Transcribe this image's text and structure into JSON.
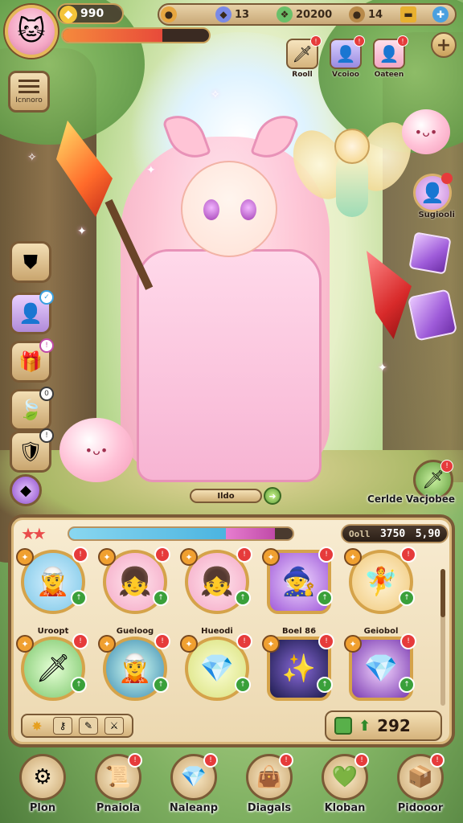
{
  "hud": {
    "gold": "990",
    "gem_a": "13",
    "gem_b": "20200",
    "gem_c": "14",
    "hp_percent": 68,
    "add_label": "+"
  },
  "menu": {
    "label": "Icnnoro"
  },
  "top_icons": [
    {
      "label": "Rooll",
      "icon": "sword-icon"
    },
    {
      "label": "Vcoioo",
      "icon": "portrait-icon"
    },
    {
      "label": "Oateen",
      "icon": "portrait-icon"
    }
  ],
  "side_buttons": [
    {
      "icon": "crest-icon"
    },
    {
      "icon": "portrait-icon"
    },
    {
      "icon": "chest-icon"
    },
    {
      "icon": "leaf-icon"
    },
    {
      "icon": "armor-icon"
    },
    {
      "icon": "gem-icon"
    }
  ],
  "right_portrait": {
    "label": "Sugiooli"
  },
  "hero_plate": {
    "label": "Ildo"
  },
  "corner_action": {
    "label": "Cerlde Vacjobee"
  },
  "panel": {
    "exp_blue_percent": 70,
    "exp_pink_percent": 22,
    "power_label": "Ooll",
    "power_value": "3750",
    "power_extra": "5,90"
  },
  "cards": [
    {
      "name": "Uroopt",
      "icon": "blue-hero",
      "shape": "round"
    },
    {
      "name": "Gueloog",
      "icon": "pink-hero",
      "shape": "round"
    },
    {
      "name": "Hueodi",
      "icon": "pink-hero",
      "shape": "round"
    },
    {
      "name": "Boel 86",
      "icon": "purple-hero",
      "shape": "sq"
    },
    {
      "name": "Geiobol",
      "icon": "blonde-hero",
      "shape": "round"
    },
    {
      "name": "",
      "icon": "weapon",
      "shape": "round"
    },
    {
      "name": "",
      "icon": "teal-hero",
      "shape": "round"
    },
    {
      "name": "",
      "icon": "crystal",
      "shape": "round"
    },
    {
      "name": "",
      "icon": "galaxy",
      "shape": "sq"
    },
    {
      "name": "",
      "icon": "gems",
      "shape": "sq"
    }
  ],
  "currency": {
    "value": "292"
  },
  "nav": [
    {
      "label": "Plon",
      "icon": "gear-icon"
    },
    {
      "label": "Pnaiola",
      "icon": "scroll-icon"
    },
    {
      "label": "Naleanp",
      "icon": "crystal-icon"
    },
    {
      "label": "Diagals",
      "icon": "bag-icon"
    },
    {
      "label": "Kloban",
      "icon": "heart-icon"
    },
    {
      "label": "Pidooor",
      "icon": "box-icon"
    }
  ]
}
